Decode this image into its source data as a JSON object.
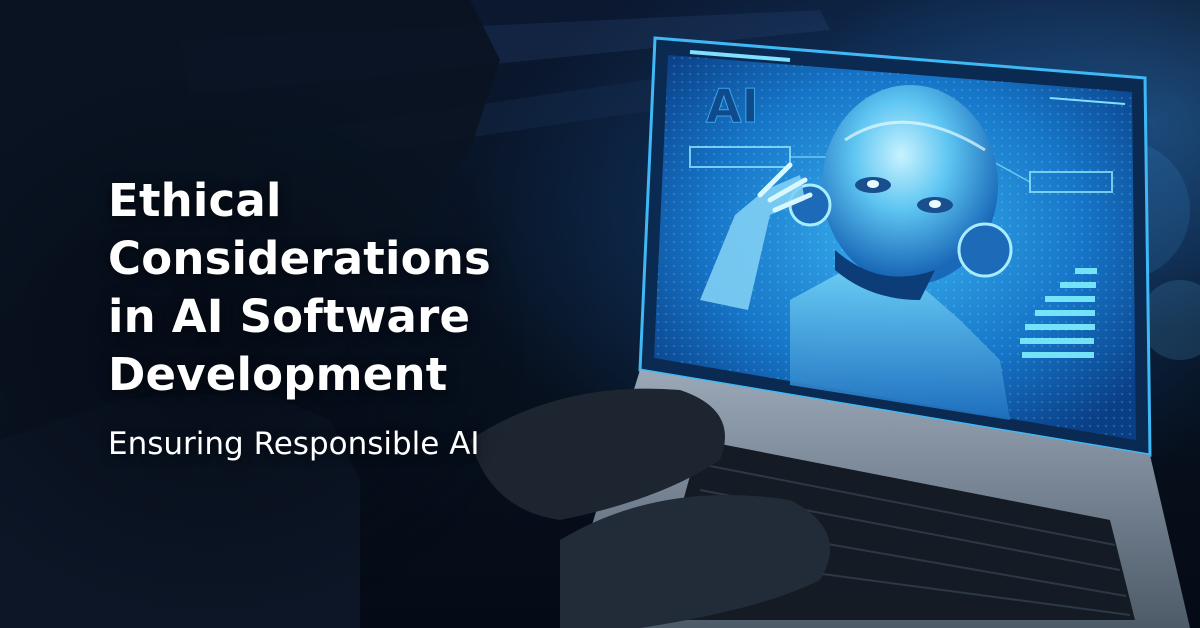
{
  "headline": {
    "lines": [
      "Ethical",
      "Considerations",
      "in AI Software",
      "Development"
    ]
  },
  "subtitle": "Ensuring Responsible AI",
  "screen": {
    "ai_label": "AI"
  },
  "colors": {
    "background": "#050d1c",
    "screen_glow": "#1e8fe0",
    "text": "#ffffff"
  }
}
